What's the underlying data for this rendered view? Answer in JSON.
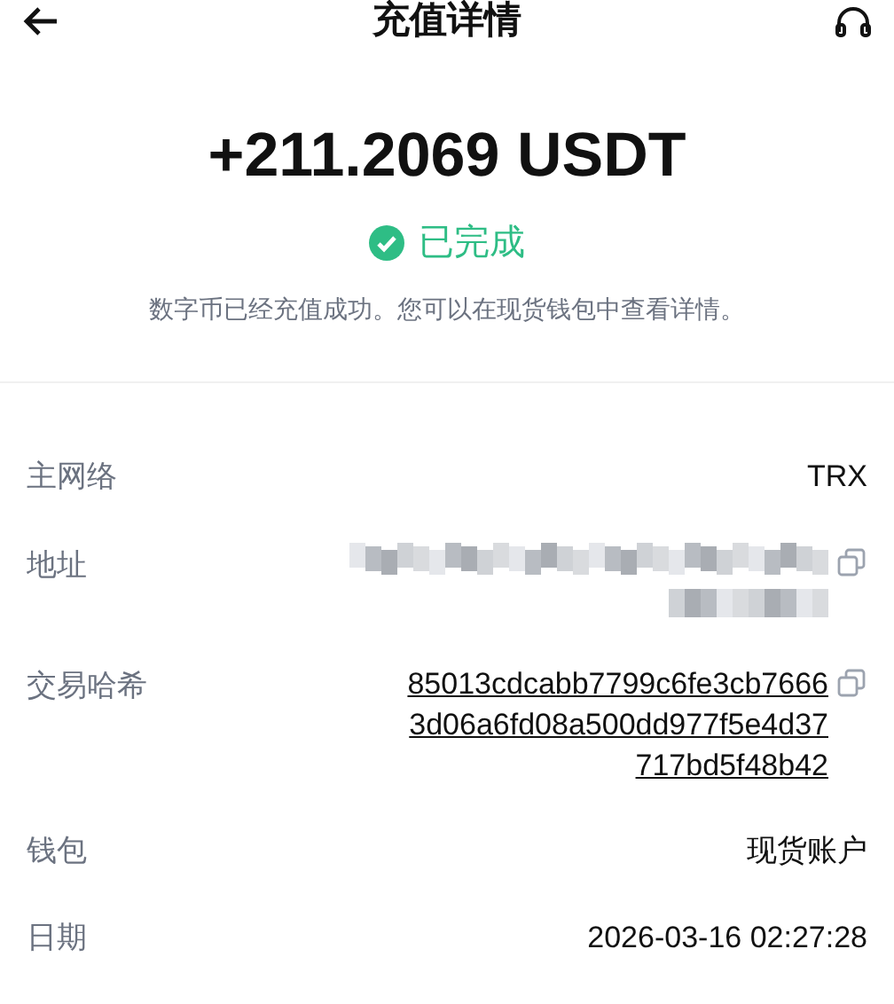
{
  "header": {
    "title": "充值详情"
  },
  "amount": "+211.2069 USDT",
  "status": {
    "label": "已完成",
    "completed": true
  },
  "message": "数字币已经充值成功。您可以在现货钱包中查看详情。",
  "details": [
    {
      "kind": "text",
      "label": "主网络",
      "value": "TRX"
    },
    {
      "kind": "hidden",
      "label": "地址",
      "copyable": true
    },
    {
      "kind": "link",
      "label": "交易哈希",
      "lines": [
        "85013cdcabb7799c6fe3cb7666",
        "3d06a6fd08a500dd977f5e4d37",
        "717bd5f48b42"
      ],
      "copyable": true
    },
    {
      "kind": "text",
      "label": "钱包",
      "value": "现货账户"
    },
    {
      "kind": "text",
      "label": "日期",
      "value": "2026-03-16 02:27:28"
    }
  ]
}
